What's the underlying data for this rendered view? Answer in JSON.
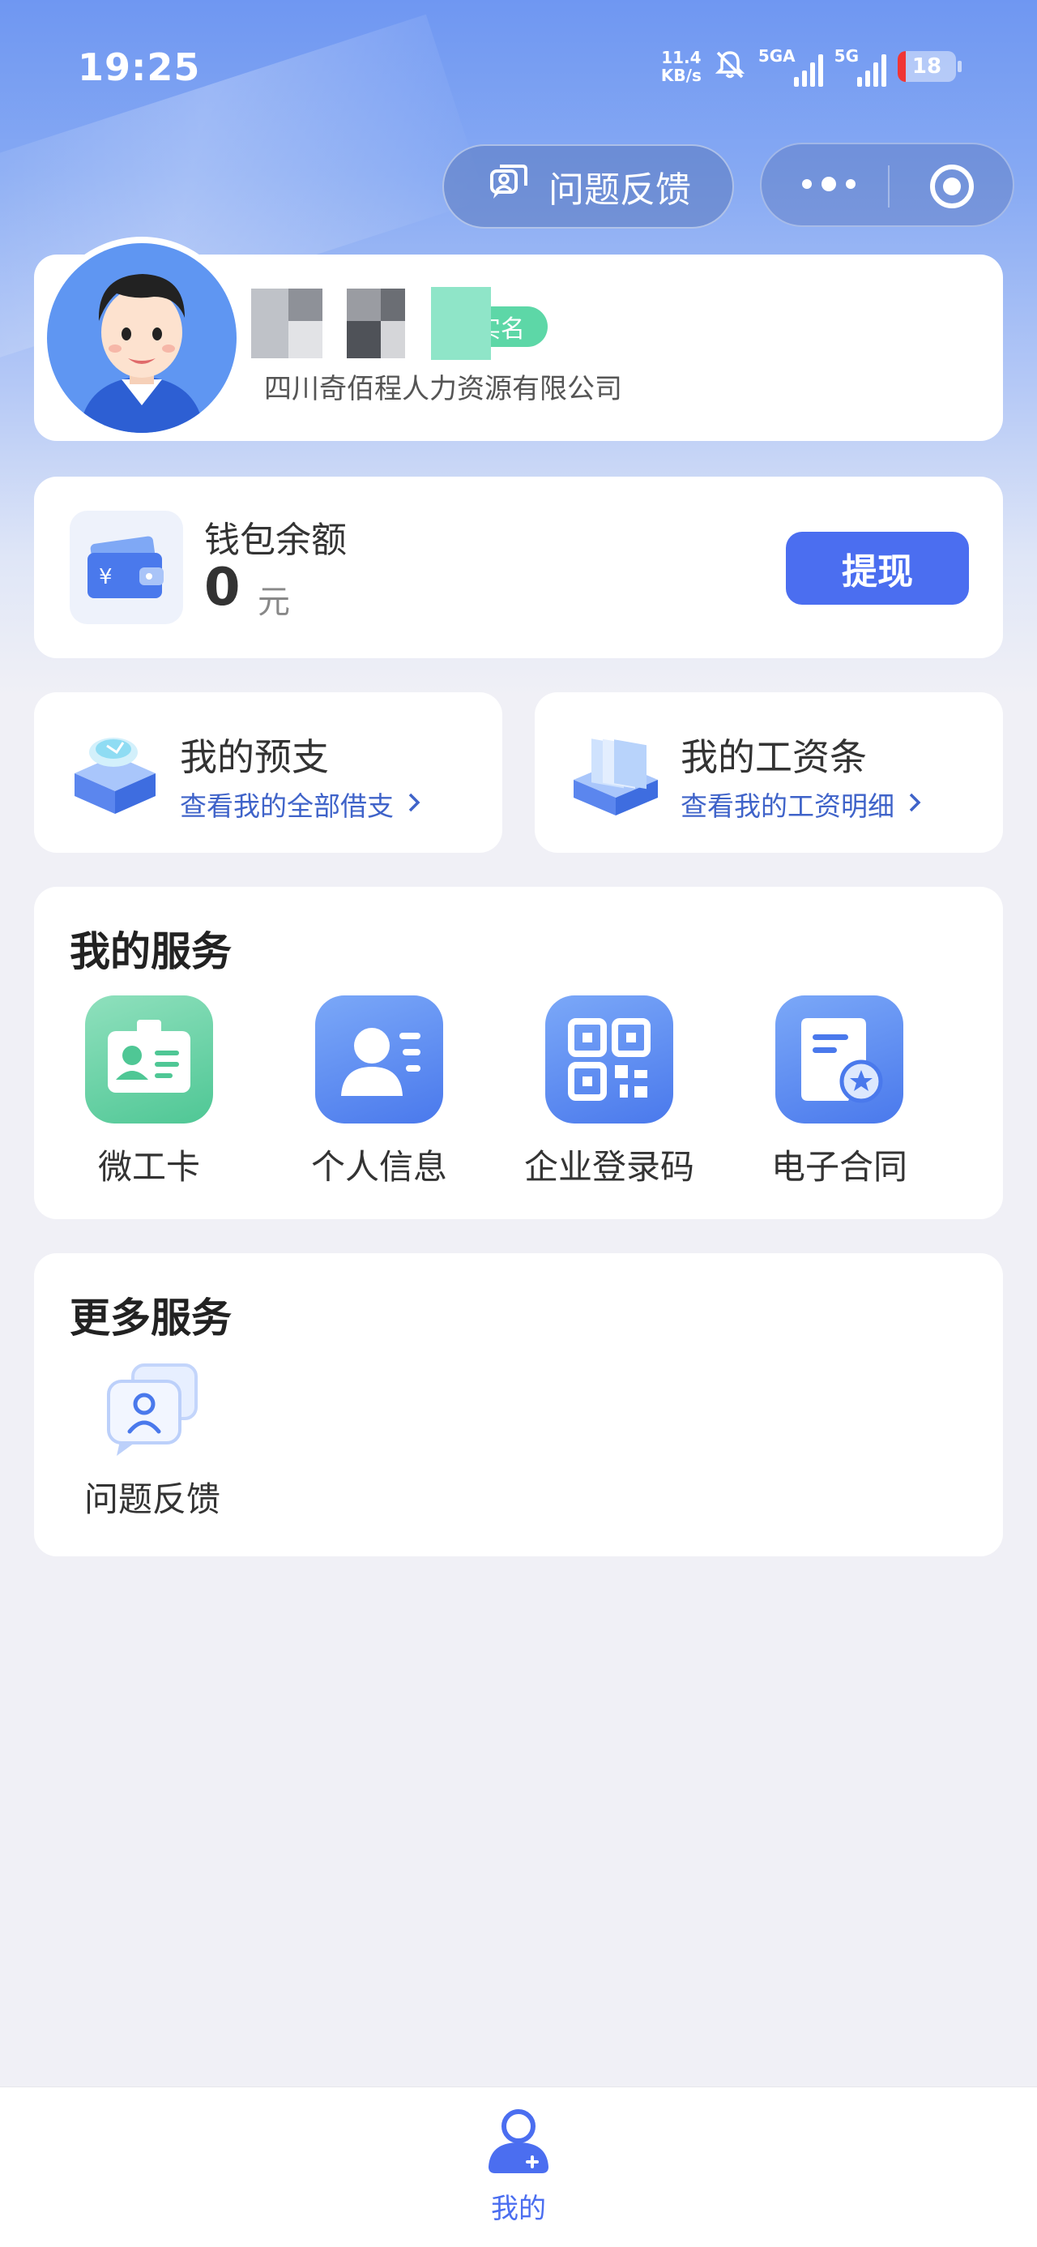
{
  "status_bar": {
    "time": "19:25",
    "net_speed_value": "11.4",
    "net_speed_unit": "KB/s",
    "network_1": "5GA",
    "network_2": "5G",
    "battery": "18",
    "icons": [
      "mute-bell-icon",
      "signal-icon",
      "signal-icon",
      "battery-icon"
    ]
  },
  "header": {
    "feedback_label": "问题反馈",
    "icons": [
      "feedback-chat-icon",
      "more-dots-icon",
      "close-target-icon"
    ]
  },
  "profile": {
    "verify_label": "实名",
    "company": "四川奇佰程人力资源有限公司"
  },
  "wallet": {
    "label": "钱包余额",
    "amount": "0",
    "unit": "元",
    "withdraw_label": "提现"
  },
  "quick_cards": [
    {
      "title": "我的预支",
      "subtitle": "查看我的全部借支",
      "icon": "advance-box-icon"
    },
    {
      "title": "我的工资条",
      "subtitle": "查看我的工资明细",
      "icon": "payslip-folder-icon"
    }
  ],
  "my_services": {
    "title": "我的服务",
    "items": [
      {
        "label": "微工卡",
        "icon": "id-card-icon"
      },
      {
        "label": "个人信息",
        "icon": "person-info-icon"
      },
      {
        "label": "企业登录码",
        "icon": "qr-code-icon"
      },
      {
        "label": "电子合同",
        "icon": "contract-icon"
      }
    ]
  },
  "more_services": {
    "title": "更多服务",
    "items": [
      {
        "label": "问题反馈",
        "icon": "feedback-user-icon"
      }
    ]
  },
  "tabbar": {
    "items": [
      {
        "label": "我的",
        "icon": "user-tab-icon",
        "active": true
      }
    ]
  },
  "colors": {
    "accent": "#4b6ef0",
    "link": "#3f63c9",
    "green": "#4fc795",
    "background": "#f0f0f6",
    "battery_low": "#f03535"
  }
}
